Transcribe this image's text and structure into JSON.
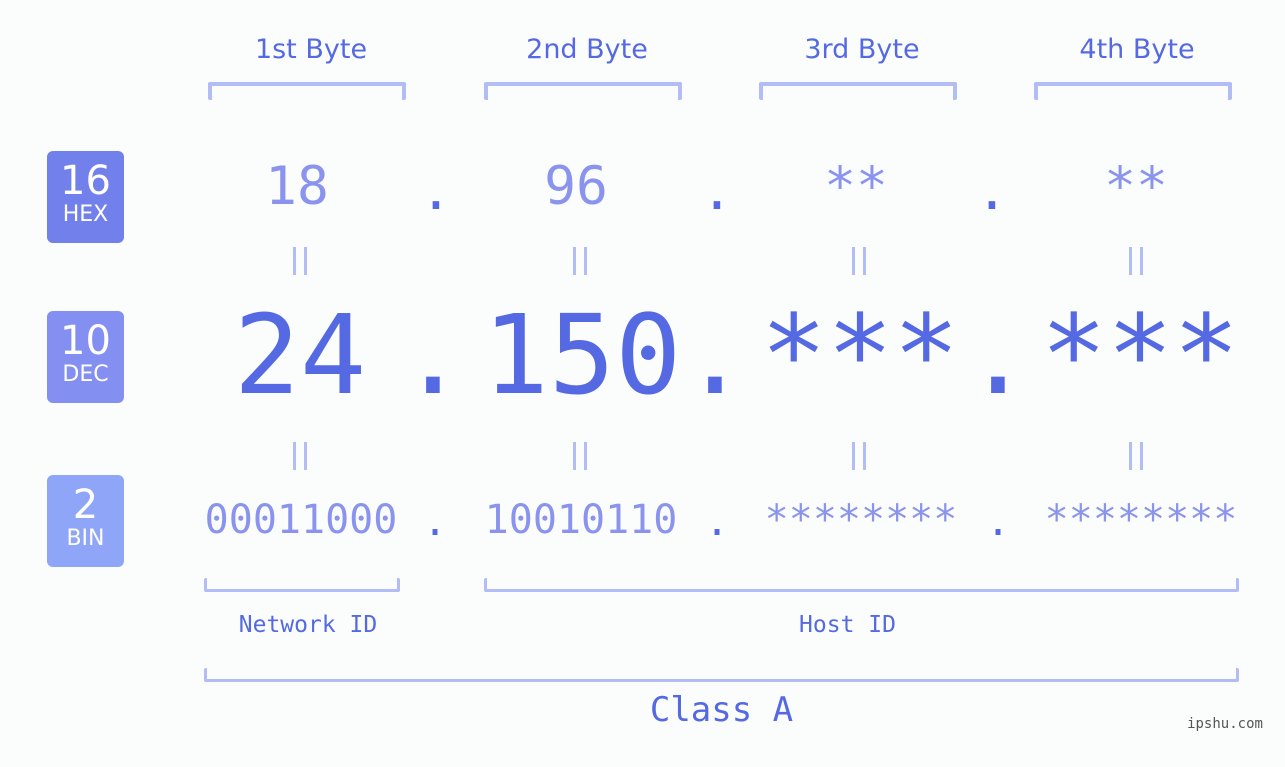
{
  "colors": {
    "primary": "#5469e2",
    "light": "#8a93ee",
    "bracket": "#b3bdf5",
    "hex_badge": "#7280eb",
    "dec_badge": "#8390f1",
    "bin_badge": "#8fa6f8",
    "background": "#fbfdfc"
  },
  "badges": [
    {
      "number": "16",
      "label": "HEX"
    },
    {
      "number": "10",
      "label": "DEC"
    },
    {
      "number": "2",
      "label": "BIN"
    }
  ],
  "byte_headers": [
    "1st Byte",
    "2nd Byte",
    "3rd Byte",
    "4th Byte"
  ],
  "separator": ".",
  "hex": [
    "18",
    "96",
    "**",
    "**"
  ],
  "dec": [
    "24",
    "150",
    "***",
    "***"
  ],
  "bin": [
    "00011000",
    "10010110",
    "********",
    "********"
  ],
  "network_id_label": "Network ID",
  "host_id_label": "Host ID",
  "class_label": "Class A",
  "watermark": "ipshu.com"
}
